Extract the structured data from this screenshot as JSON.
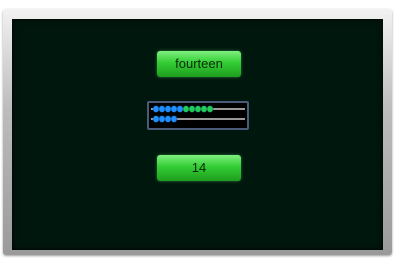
{
  "word_label": "fourteen",
  "number_label": "14",
  "abacus": {
    "rows": [
      {
        "beads": [
          {
            "color": "#1f8fff"
          },
          {
            "color": "#1f8fff"
          },
          {
            "color": "#1f8fff"
          },
          {
            "color": "#1f8fff"
          },
          {
            "color": "#1f8fff"
          },
          {
            "color": "#22cc55"
          },
          {
            "color": "#22cc55"
          },
          {
            "color": "#22cc55"
          },
          {
            "color": "#22cc55"
          },
          {
            "color": "#22cc55"
          }
        ]
      },
      {
        "beads": [
          {
            "color": "#1f8fff"
          },
          {
            "color": "#1f8fff"
          },
          {
            "color": "#1f8fff"
          },
          {
            "color": "#1f8fff"
          }
        ]
      }
    ]
  },
  "colors": {
    "board": "#00170d",
    "button_green": "#33cc33",
    "rod": "#cccccc"
  }
}
